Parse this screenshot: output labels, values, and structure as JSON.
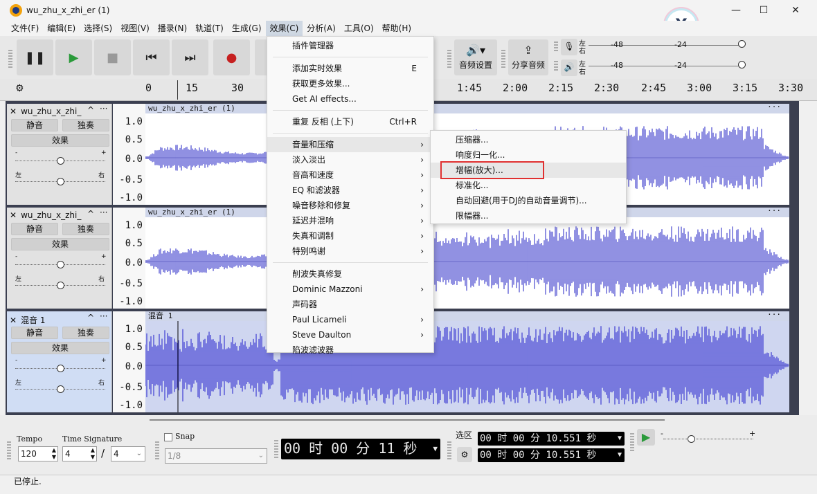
{
  "window": {
    "title": "wu_zhu_x_zhi_er (1)",
    "minimize": "—",
    "maximize": "☐",
    "close": "✕"
  },
  "menubar": [
    "文件(F)",
    "编辑(E)",
    "选择(S)",
    "视图(V)",
    "播录(N)",
    "轨道(T)",
    "生成(G)",
    "效果(C)",
    "分析(A)",
    "工具(O)",
    "帮助(H)"
  ],
  "toolbar": {
    "audio_setup": "音频设置",
    "share_audio": "分享音频",
    "meter_left": "左",
    "meter_right": "右",
    "meter_ticks": [
      "-48",
      "-24"
    ]
  },
  "ruler_ticks": [
    "0",
    "15",
    "30",
    "1:45",
    "2:00",
    "2:15",
    "2:30",
    "2:45",
    "3:00",
    "3:15",
    "3:30"
  ],
  "tracks": [
    {
      "name": "wu_zhu_x_zhi_",
      "clip": "wu_zhu_x_zhi_er (1)",
      "mute": "静音",
      "solo": "独奏",
      "effects": "效果",
      "left": "左",
      "right": "右"
    },
    {
      "name": "wu_zhu_x_zhi_",
      "clip": "wu_zhu_x_zhi_er (1)",
      "mute": "静音",
      "solo": "独奏",
      "effects": "效果",
      "left": "左",
      "right": "右"
    },
    {
      "name": "混音 1",
      "clip": "混音 1",
      "mute": "静音",
      "solo": "独奏",
      "effects": "效果",
      "left": "左",
      "right": "右"
    }
  ],
  "scale_labels": [
    "1.0",
    "0.5",
    "0.0",
    "-0.5",
    "-1.0"
  ],
  "effects_menu": {
    "items": [
      {
        "label": "插件管理器"
      },
      {
        "label": "添加实时效果",
        "accel": "E"
      },
      {
        "label": "获取更多效果..."
      },
      {
        "label": "Get AI effects..."
      },
      {
        "label": "重复 反相 (上下)",
        "accel": "Ctrl+R"
      },
      {
        "label": "音量和压缩",
        "sub": true
      },
      {
        "label": "淡入淡出",
        "sub": true
      },
      {
        "label": "音高和速度",
        "sub": true
      },
      {
        "label": "EQ 和滤波器",
        "sub": true
      },
      {
        "label": "噪音移除和修复",
        "sub": true
      },
      {
        "label": "延迟并混响",
        "sub": true
      },
      {
        "label": "失真和调制",
        "sub": true
      },
      {
        "label": "特别鸣谢",
        "sub": true
      },
      {
        "label": "削波失真修复"
      },
      {
        "label": "Dominic Mazzoni",
        "sub": true
      },
      {
        "label": "声码器"
      },
      {
        "label": "Paul Licameli",
        "sub": true
      },
      {
        "label": "Steve Daulton",
        "sub": true
      },
      {
        "label": "陷波滤波器"
      }
    ]
  },
  "volume_submenu": [
    "压缩器...",
    "响度归一化...",
    "增幅(放大)...",
    "标准化...",
    "自动回避(用于DJ的自动音量调节)...",
    "限幅器..."
  ],
  "bottom": {
    "tempo_label": "Tempo",
    "tempo_value": "120",
    "timesig_label": "Time Signature",
    "timesig_num": "4",
    "timesig_den": "4",
    "snap_label": "Snap",
    "snap_value": "1/8",
    "time_display": "00 时 00 分 11 秒",
    "selection_label": "选区",
    "sel_start": "00 时 00 分 10.551 秒",
    "sel_end": "00 时 00 分 10.551 秒"
  },
  "status": "已停止."
}
